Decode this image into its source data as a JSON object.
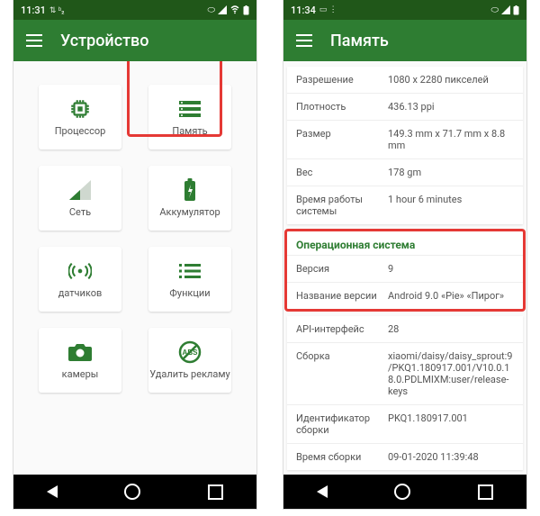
{
  "left": {
    "status": {
      "time": "11:31",
      "icons_left": "↕ ⋮",
      "icons_right": "⬭ ▾▮◢▮"
    },
    "appbar": {
      "title": "Устройство"
    },
    "grid": [
      {
        "label": "Процессор",
        "icon": "cpu"
      },
      {
        "label": "Память",
        "icon": "memory"
      },
      {
        "label": "Сеть",
        "icon": "signal"
      },
      {
        "label": "Аккумулятор",
        "icon": "battery"
      },
      {
        "label": "датчиков",
        "icon": "sensor"
      },
      {
        "label": "Функции",
        "icon": "list"
      },
      {
        "label": "камеры",
        "icon": "camera"
      },
      {
        "label": "Удалить рекламу",
        "icon": "abs"
      }
    ]
  },
  "right": {
    "status": {
      "time": "11:34",
      "icons_left": "▭ ⋮",
      "icons_right": "⬭ ◢▮"
    },
    "appbar": {
      "title": "Память"
    },
    "top_rows": [
      {
        "k": "Разрешение",
        "v": "1080 x 2280 пикселей"
      },
      {
        "k": "Плотность",
        "v": "436.13 ppi"
      },
      {
        "k": "Размер",
        "v": "149.3 mm x 71.7 mm x 8.8 mm"
      },
      {
        "k": "Вес",
        "v": "178 gm"
      },
      {
        "k": "Время работы системы",
        "v": "1 hour 6 minutes"
      }
    ],
    "os": {
      "header": "Операционная система",
      "rows": [
        {
          "k": "Версия",
          "v": "9"
        },
        {
          "k": "Название версии",
          "v": "Android 9.0 «Pie» «Пирог»"
        }
      ]
    },
    "bottom_rows": [
      {
        "k": "API-интерфейс",
        "v": "28"
      },
      {
        "k": "Сборка",
        "v": "xiaomi/daisy/daisy_sprout:9/PKQ1.180917.001/V10.0.18.0.PDLMIXM:user/release-keys"
      },
      {
        "k": "Идентификатор сборки",
        "v": "PKQ1.180917.001"
      },
      {
        "k": "Время сборки",
        "v": "09-01-2020 11:39:48"
      }
    ]
  }
}
